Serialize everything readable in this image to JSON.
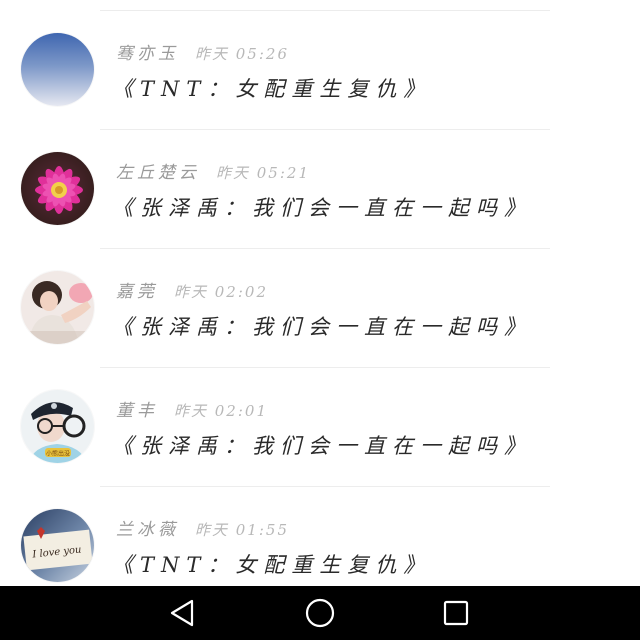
{
  "feed": {
    "items": [
      {
        "name": "骞亦玉",
        "time": "昨天 05:26",
        "title": "《TNT：女配重生复仇》",
        "avatar": "gradient-blue-avatar"
      },
      {
        "name": "左丘楚云",
        "time": "昨天 05:21",
        "title": "《张泽禹：我们会一直在一起吗》",
        "avatar": "pink-flower-avatar"
      },
      {
        "name": "嘉莞",
        "time": "昨天 02:02",
        "title": "《张泽禹：我们会一直在一起吗》",
        "avatar": "girl-photo-avatar"
      },
      {
        "name": "董丰",
        "time": "昨天 02:01",
        "title": "《张泽禹：我们会一直在一起吗》",
        "avatar": "boy-cap-glasses-avatar"
      },
      {
        "name": "兰冰薇",
        "time": "昨天 01:55",
        "title": "《TNT：女配重生复仇》",
        "avatar": "i-love-you-avatar"
      }
    ]
  },
  "avatar_texts": {
    "love_note": "I love you",
    "badge": "小熊出没"
  },
  "colors": {
    "name": "#9a9a9a",
    "time": "#b8b8b8",
    "title": "#2a2a2a",
    "navbar": "#000000",
    "nav_icon": "#ffffff"
  },
  "navbar": {
    "icons": [
      "back-triangle-icon",
      "home-circle-icon",
      "recents-square-icon"
    ]
  }
}
